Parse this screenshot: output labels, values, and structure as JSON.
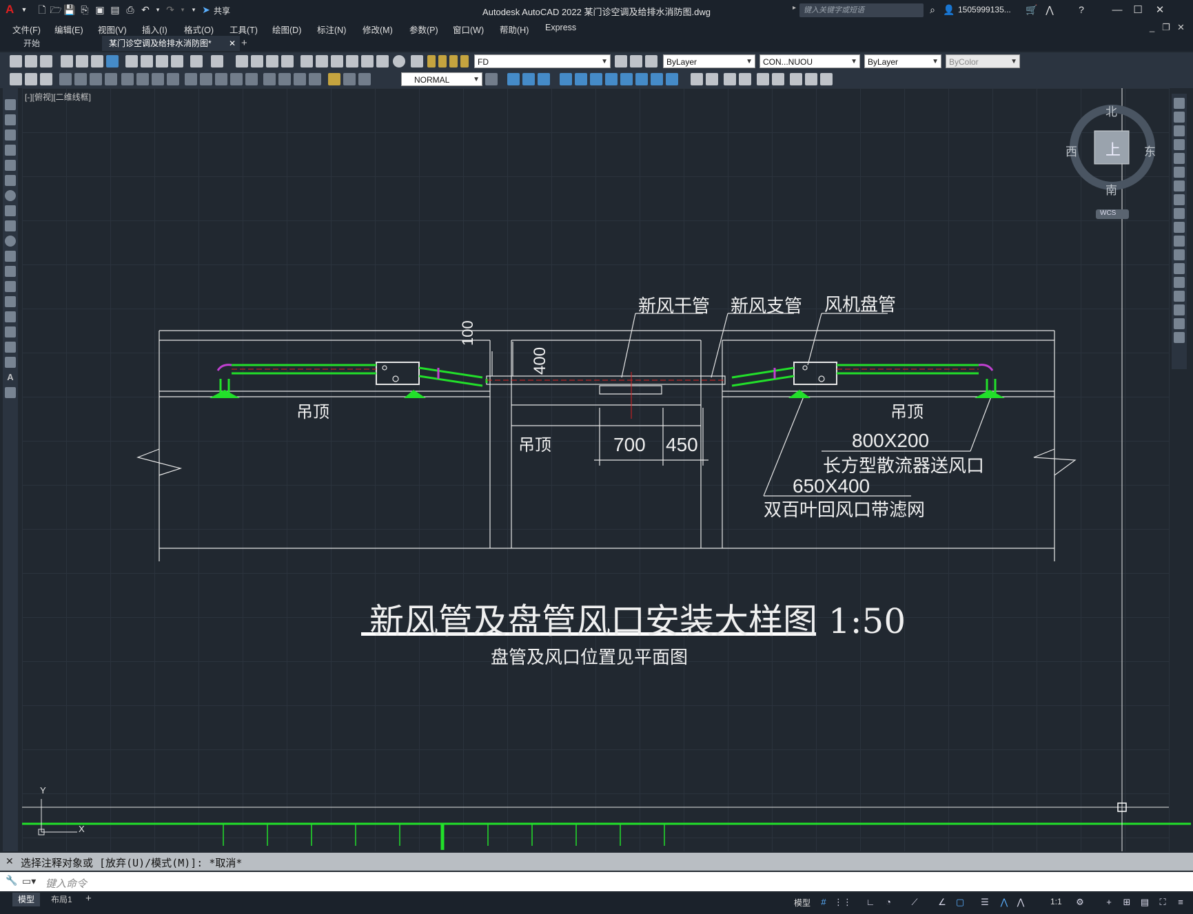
{
  "app": {
    "logo": "A",
    "title": "Autodesk AutoCAD 2022    某门诊空调及给排水消防图.dwg",
    "share_label": "共享",
    "search_placeholder": "键入关键字或短语",
    "user": "1505999135...",
    "window_controls": [
      "—",
      "☐",
      "✕"
    ]
  },
  "menus": [
    "文件(F)",
    "编辑(E)",
    "视图(V)",
    "插入(I)",
    "格式(O)",
    "工具(T)",
    "绘图(D)",
    "标注(N)",
    "修改(M)",
    "参数(P)",
    "窗口(W)",
    "帮助(H)",
    "Express"
  ],
  "doc_tabs": [
    {
      "label": "开始"
    },
    {
      "label": "某门诊空调及给排水消防图*"
    }
  ],
  "toolbar": {
    "layer": "FD",
    "color": "ByLayer",
    "linetype": "CON...NUOU",
    "lineweight": "ByLayer",
    "plotstyle": "ByColor",
    "textstyle": "NORMAL"
  },
  "viewport": {
    "label": "[-][俯视][二维线框]",
    "viewcube": {
      "north": "北",
      "south": "南",
      "east": "东",
      "west": "西",
      "top": "上",
      "wcs": "WCS"
    },
    "ucs": {
      "x": "X",
      "y": "Y"
    }
  },
  "drawing": {
    "labels": {
      "main_duct": "新风干管",
      "branch_duct": "新风支管",
      "fan_coil": "风机盘管",
      "ceiling": "吊顶",
      "dim_100": "100",
      "dim_400": "400",
      "dim_700": "700",
      "dim_450": "450",
      "diffuser_size": "800X200",
      "diffuser_name": "长方型散流器送风口",
      "grille_size": "650X400",
      "grille_name": "双百叶回风口带滤网"
    },
    "title": "新风管及盘管风口安装大样图 1:50",
    "subtitle": "盘管及风口位置见平面图"
  },
  "command": {
    "history": "选择注释对象或 [放弃(U)/模式(M)]: *取消*",
    "placeholder": "键入命令"
  },
  "status": {
    "layout_tabs": [
      "模型",
      "布局1"
    ],
    "model_label": "模型",
    "scale": "1:1"
  }
}
